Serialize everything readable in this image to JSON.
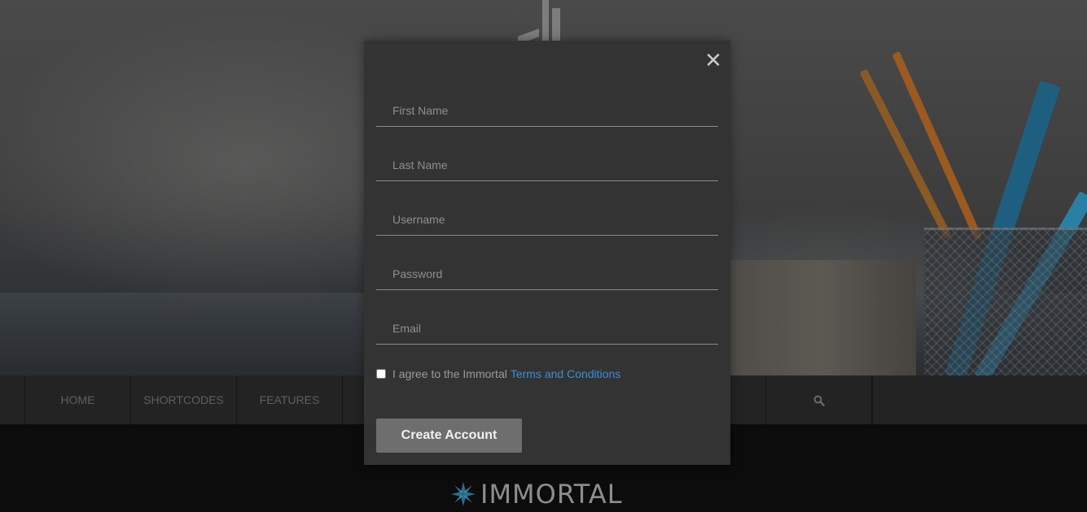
{
  "nav": {
    "items": [
      {
        "label": "HOME"
      },
      {
        "label": "SHORTCODES"
      },
      {
        "label": "FEATURES"
      }
    ],
    "search_icon": "search-icon"
  },
  "brand": {
    "name": "IMMORTAL",
    "icon": "leaf-logo-icon",
    "accent": "#2b6f88"
  },
  "modal": {
    "close_icon": "close-icon",
    "close_glyph": "✕",
    "fields": {
      "first_name": {
        "placeholder": "First Name",
        "value": ""
      },
      "last_name": {
        "placeholder": "Last Name",
        "value": ""
      },
      "username": {
        "placeholder": "Username",
        "value": ""
      },
      "password": {
        "placeholder": "Password",
        "value": ""
      },
      "email": {
        "placeholder": "Email",
        "value": ""
      }
    },
    "agree_text": "I agree to the Immortal",
    "terms_link": "Terms and Conditions",
    "agree_checked": false,
    "submit_label": "Create Account"
  },
  "colors": {
    "modal_bg": "#333333",
    "link": "#3a8ed6",
    "button_bg": "#6e6e6e",
    "nav_bg": "#232323"
  }
}
